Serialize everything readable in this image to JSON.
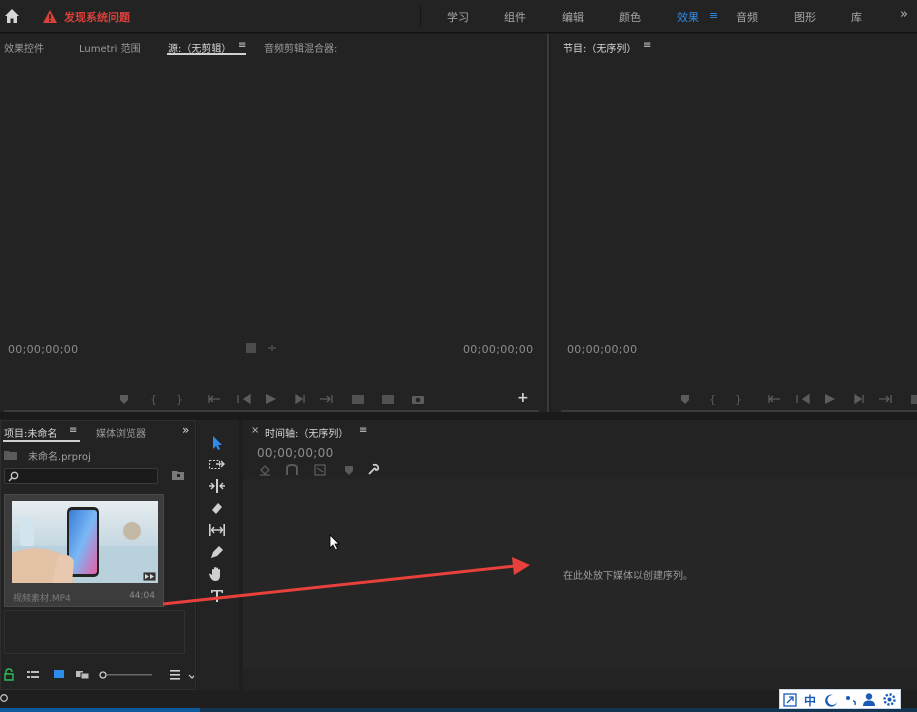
{
  "header": {
    "warning_text": "发现系统问题",
    "workspaces": [
      "学习",
      "组件",
      "编辑",
      "颜色",
      "效果",
      "音频",
      "图形",
      "库"
    ],
    "active_workspace": "效果",
    "menu_glyph": "≡",
    "overflow_glyph": "»"
  },
  "source_panel": {
    "tabs": {
      "effect_controls": "效果控件",
      "lumetri": "Lumetri 范围",
      "source": "源:（无剪辑）",
      "mixer": "音频剪辑混合器:"
    },
    "menu_glyph": "≡",
    "timecode_left": "00;00;00;00",
    "timecode_right": "00;00;00;00"
  },
  "program_panel": {
    "title": "节目:（无序列）",
    "menu_glyph": "≡",
    "timecode": "00;00;00;00"
  },
  "project_panel": {
    "tab_project": "项目:未命名",
    "tab_media_browser": "媒体浏览器",
    "menu_glyph": "≡",
    "more_glyph": "»",
    "project_file": "未命名.prproj",
    "clip": {
      "name": "视频素材.MP4",
      "duration": "44:04"
    }
  },
  "timeline_panel": {
    "close_glyph": "×",
    "title": "时间轴:（无序列）",
    "menu_glyph": "≡",
    "timecode": "00;00;00;00",
    "drop_hint": "在此处放下媒体以创建序列。"
  },
  "tools": [
    "selection-tool",
    "track-select-tool",
    "ripple-edit-tool",
    "razor-tool",
    "slip-tool",
    "pen-tool",
    "hand-tool",
    "type-tool"
  ],
  "ime_tray": {
    "lang": "中"
  },
  "colors": {
    "accent": "#2d8ceb",
    "warning": "#d9413b",
    "annotation_arrow": "#e8403a"
  }
}
